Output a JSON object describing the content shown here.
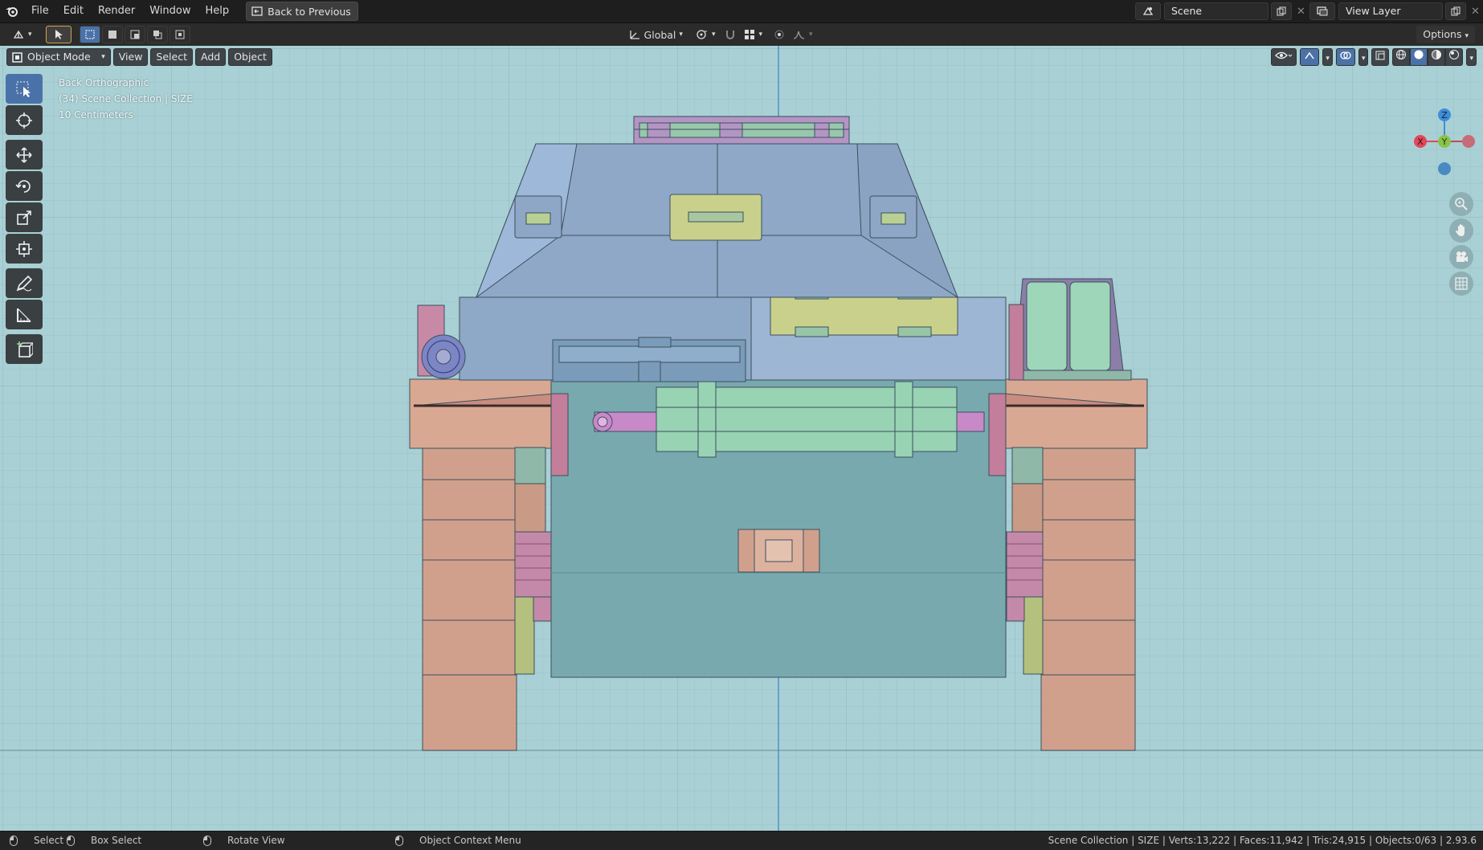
{
  "topbar": {
    "menu": [
      "File",
      "Edit",
      "Render",
      "Window",
      "Help"
    ],
    "back_button": "Back to Previous",
    "scene_name": "Scene",
    "view_layer_name": "View Layer"
  },
  "header": {
    "orientation": "Global",
    "options_label": "Options"
  },
  "viewport": {
    "mode": "Object Mode",
    "menus": [
      "View",
      "Select",
      "Add",
      "Object"
    ],
    "info": {
      "view_name": "Back Orthographic",
      "collection": "(34) Scene Collection | SIZE",
      "scale": "10 Centimeters"
    },
    "gizmo": {
      "x": "X",
      "y": "Y",
      "z": "Z"
    },
    "colors": {
      "background": "#a9d0d4",
      "x_axis": "#e0485a",
      "y_axis": "#8bc34a",
      "z_axis": "#3e8ed8"
    }
  },
  "tools": [
    "select-box-tool",
    "cursor-tool",
    "move-tool",
    "rotate-tool",
    "scale-tool",
    "transform-tool",
    "annotate-tool",
    "measure-tool",
    "add-cube-tool"
  ],
  "statusbar": {
    "select": "Select",
    "box_select": "Box Select",
    "rotate_view": "Rotate View",
    "context_menu": "Object Context Menu",
    "stats": "Scene Collection | SIZE | Verts:13,222 | Faces:11,942 | Tris:24,915 | Objects:0/63 | 2.93.6"
  }
}
